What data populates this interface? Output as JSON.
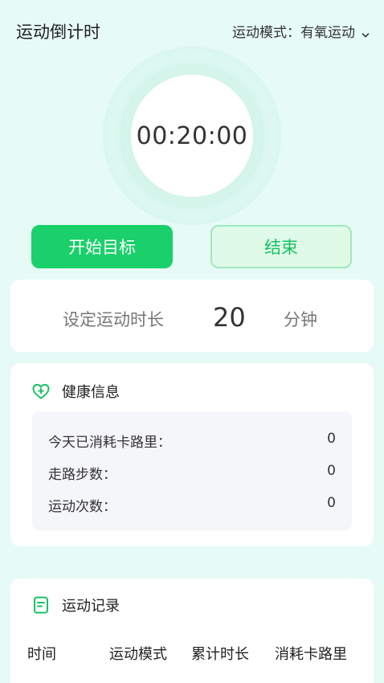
{
  "header": {
    "title": "运动倒计时",
    "mode_label": "运动模式：",
    "mode_value": "有氧运动"
  },
  "timer": {
    "display": "00:20:00"
  },
  "buttons": {
    "start_label": "开始目标",
    "end_label": "结束"
  },
  "duration": {
    "label": "设定运动时长",
    "value": "20",
    "unit": "分钟"
  },
  "health": {
    "title": "健康信息",
    "rows": [
      {
        "label": "今天已消耗卡路里：",
        "value": "0"
      },
      {
        "label": "走路步数：",
        "value": "0"
      },
      {
        "label": "运动次数：",
        "value": "0"
      }
    ]
  },
  "records": {
    "title": "运动记录",
    "columns": [
      "时间",
      "运动模式",
      "累计时长",
      "消耗卡路里"
    ]
  },
  "colors": {
    "accent_green": "#19d06a",
    "background": "#e6faf6"
  }
}
